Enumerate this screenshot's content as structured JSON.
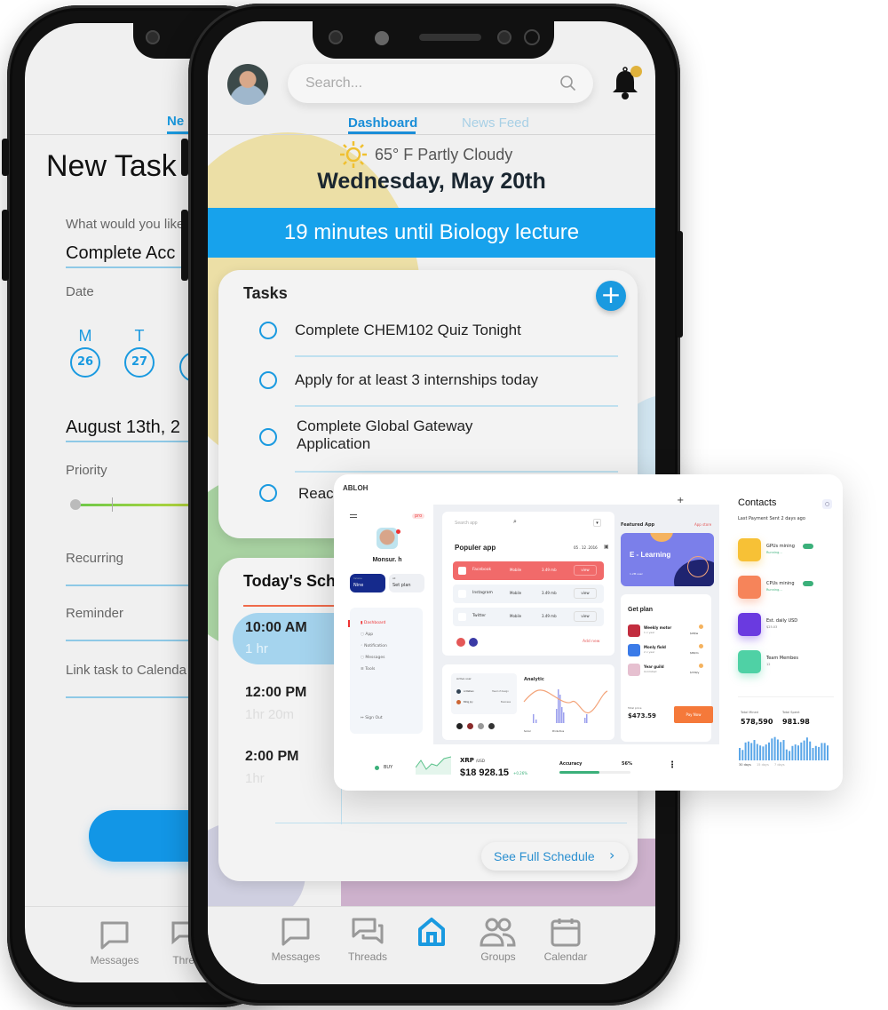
{
  "back_phone": {
    "tab_label": "Ne",
    "title": "New Task",
    "question_label": "What would you like",
    "task_name_value": "Complete Acc",
    "date_label": "Date",
    "days": [
      {
        "letter": "M",
        "num": "26"
      },
      {
        "letter": "T",
        "num": "27"
      }
    ],
    "selected_date": "August 13th, 2",
    "priority_label": "Priority",
    "recurring_label": "Recurring",
    "reminder_label": "Reminder",
    "link_calendar_label": "Link task to Calenda",
    "nav": [
      {
        "label": "Messages",
        "icon": "message-icon"
      },
      {
        "label": "Threa",
        "icon": "threads-icon"
      }
    ]
  },
  "front_phone": {
    "search_placeholder": "Search...",
    "tabs": [
      {
        "label": "Dashboard",
        "active": true
      },
      {
        "label": "News Feed",
        "active": false
      }
    ],
    "weather": "65° F Partly Cloudy",
    "date": "Wednesday, May 20th",
    "banner": "19 minutes until Biology lecture",
    "tasks": {
      "title": "Tasks",
      "items": [
        {
          "text": "Complete CHEM102 Quiz Tonight"
        },
        {
          "text": "Apply for at least 3 internships today"
        },
        {
          "text": "Complete Global Gateway Application"
        },
        {
          "text": "Reac"
        }
      ]
    },
    "schedule": {
      "title": "Today's Sch",
      "items": [
        {
          "time": "10:00 AM",
          "duration": "1 hr",
          "active": true
        },
        {
          "time": "12:00 PM",
          "duration": "1hr 20m",
          "active": false
        },
        {
          "time": "2:00 PM",
          "duration": "1hr",
          "active": false
        }
      ],
      "see_full": "See Full Schedule"
    },
    "nav": [
      {
        "label": "Messages",
        "icon": "message-icon"
      },
      {
        "label": "Threads",
        "icon": "threads-icon"
      },
      {
        "label": "",
        "icon": "home-icon",
        "active": true
      },
      {
        "label": "Groups",
        "icon": "groups-icon"
      },
      {
        "label": "Calendar",
        "icon": "calendar-icon"
      }
    ]
  },
  "dashboard": {
    "brand": "ABLOH",
    "badge": "pro",
    "user_name": "Monsur. h",
    "plan_cards": [
      {
        "small": "Income",
        "value": "Nine"
      },
      {
        "small": "All",
        "value": "Set plan"
      }
    ],
    "menu": [
      {
        "label": "Dashboard",
        "active": true
      },
      {
        "label": "App"
      },
      {
        "label": "Notification"
      },
      {
        "label": "Messages"
      },
      {
        "label": "Tools"
      }
    ],
    "sign_out": "Sign Out",
    "search_placeholder": "Search app",
    "popular_title": "Populer app",
    "popular_date": "05 . 12 .2016",
    "apps": [
      {
        "name": "Facebook",
        "platform": "Mobile",
        "size": "3.49 mb",
        "action": "view"
      },
      {
        "name": "Instagram",
        "platform": "Mobile",
        "size": "3.49 mb",
        "action": "view"
      },
      {
        "name": "Twitter",
        "platform": "Mobile",
        "size": "3.49 mb",
        "action": "view"
      }
    ],
    "add_new": "Add new",
    "featured_title": "Featured App",
    "app_store": "App store",
    "featured_name": "E - Learning",
    "featured_users": "1.2M user",
    "plan_title": "Get plan",
    "plans": [
      {
        "name": "Weekly motor",
        "sub": "1 x year",
        "price": "$08/w"
      },
      {
        "name": "Monly fiold",
        "sub": "2 x year",
        "price": "$86/m"
      },
      {
        "name": "Year guild",
        "sub": "Unlimited",
        "price": "$339/y"
      }
    ],
    "total_label": "Total price",
    "total_value": "$473.59",
    "pay_now": "Pay Now",
    "active_user_title": "Active user",
    "active_users": [
      {
        "name": "Al Rafsan",
        "role": "Head of design"
      },
      {
        "name": "Billig Joy",
        "role": "Business"
      }
    ],
    "analytic_title": "Analytic",
    "analytic_legend": [
      "Social",
      "Productive"
    ],
    "buy_label": "BUY",
    "xrp_label": "XRP",
    "xrp_pair": "/USD",
    "xrp_price": "$18 928.15",
    "xrp_change": "+0.26%",
    "accuracy_label": "Accuracy",
    "accuracy_value": "56%",
    "accuracy_fraction": 0.56,
    "contacts_title": "Contacts",
    "contacts_sub": "Last Payment Sent 2 days ago",
    "contacts": [
      {
        "title": "GPUs mining",
        "sub": "Running...",
        "color": "#f7c136",
        "toggle": true
      },
      {
        "title": "CPUs mining",
        "sub": "Running...",
        "color": "#f6845a",
        "toggle": true
      },
      {
        "title": "Est. daily USD",
        "sub": "$25.03",
        "color": "#6a3ae0",
        "toggle": false
      },
      {
        "title": "Team Membes",
        "sub": "12",
        "color": "#4fd1a5",
        "toggle": false
      }
    ],
    "total_mined_label": "Total Mined",
    "total_mined": "578,590",
    "total_spent_label": "Total Spent",
    "total_spent": "981.98",
    "ranges": [
      "30 days",
      "15 days",
      "7 days"
    ],
    "bars": [
      0.5,
      0.42,
      0.72,
      0.76,
      0.7,
      0.82,
      0.66,
      0.6,
      0.56,
      0.64,
      0.72,
      0.88,
      0.94,
      0.84,
      0.74,
      0.82,
      0.44,
      0.38,
      0.58,
      0.64,
      0.6,
      0.72,
      0.8,
      0.92,
      0.76,
      0.5,
      0.58,
      0.54,
      0.7,
      0.7,
      0.6
    ]
  }
}
